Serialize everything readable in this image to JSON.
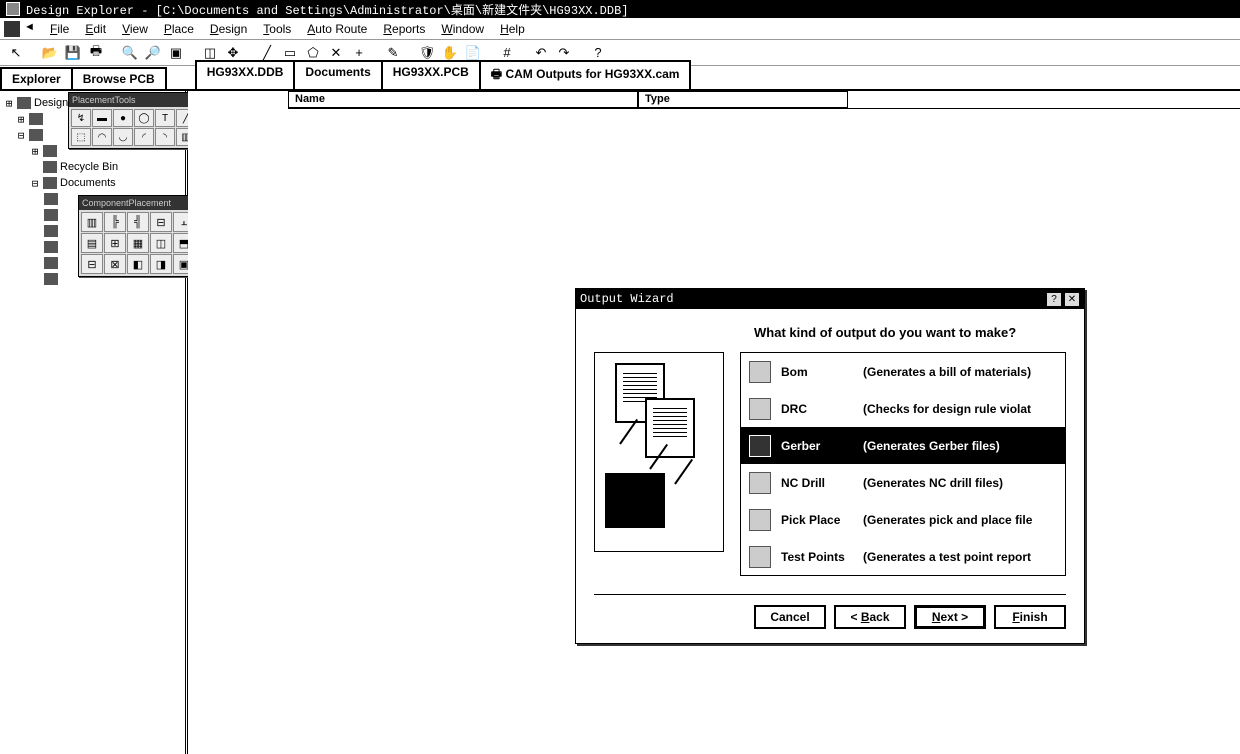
{
  "title": "Design Explorer - [C:\\Documents and Settings\\Administrator\\桌面\\新建文件夹\\HG93XX.DDB]",
  "menu": [
    "File",
    "Edit",
    "View",
    "Place",
    "Design",
    "Tools",
    "Auto Route",
    "Reports",
    "Window",
    "Help"
  ],
  "left_tabs": [
    "Explorer",
    "Browse PCB"
  ],
  "doc_tabs": [
    "HG93XX.DDB",
    "Documents",
    "HG93XX.PCB",
    "CAM Outputs for HG93XX.cam"
  ],
  "tree": {
    "root": "Design",
    "recycle": "Recycle Bin",
    "documents": "Documents"
  },
  "float1_title": "PlacementTools",
  "float2_title": "ComponentPlacement",
  "list_cols": [
    "Name",
    "Type"
  ],
  "dialog": {
    "title": "Output Wizard",
    "question": "What kind of output do you want to make?",
    "options": [
      {
        "name": "Bom",
        "desc": "(Generates a bill of materials)"
      },
      {
        "name": "DRC",
        "desc": "(Checks for design rule violat"
      },
      {
        "name": "Gerber",
        "desc": "(Generates Gerber files)"
      },
      {
        "name": "NC Drill",
        "desc": "(Generates NC drill files)"
      },
      {
        "name": "Pick Place",
        "desc": "(Generates pick and place file"
      },
      {
        "name": "Test Points",
        "desc": "(Generates a test point report"
      }
    ],
    "selected": 2,
    "buttons": {
      "cancel": "Cancel",
      "back": "< Back",
      "next": "Next >",
      "finish": "Finish"
    }
  }
}
